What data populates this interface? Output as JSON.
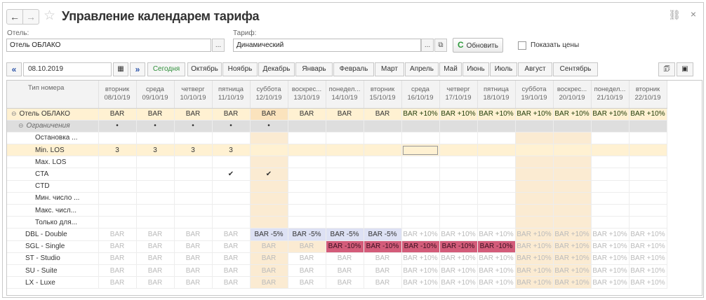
{
  "window": {
    "title": "Управление календарем тарифа"
  },
  "hotel": {
    "label": "Отель:",
    "value": "Отель ОБЛАКО",
    "select_label": "..."
  },
  "tariff": {
    "label": "Тариф:",
    "value": "Динамический",
    "select_label": "..."
  },
  "toolbar": {
    "refresh_label": "Обновить",
    "show_prices_label": "Показать цены"
  },
  "datebar": {
    "date": "08.10.2019",
    "today_label": "Сегодня",
    "months": [
      "Октябрь",
      "Ноябрь",
      "Декабрь",
      "Январь",
      "Февраль",
      "Март",
      "Апрель",
      "Май",
      "Июнь",
      "Июль",
      "Август",
      "Сентябрь"
    ]
  },
  "grid": {
    "room_header": "Тип номера",
    "columns": [
      {
        "day": "вторник",
        "date": "08/10/19"
      },
      {
        "day": "среда",
        "date": "09/10/19"
      },
      {
        "day": "четверг",
        "date": "10/10/19"
      },
      {
        "day": "пятница",
        "date": "11/10/19"
      },
      {
        "day": "суббота",
        "date": "12/10/19"
      },
      {
        "day": "воскрес...",
        "date": "13/10/19"
      },
      {
        "day": "понедел...",
        "date": "14/10/19"
      },
      {
        "day": "вторник",
        "date": "15/10/19"
      },
      {
        "day": "среда",
        "date": "16/10/19"
      },
      {
        "day": "четверг",
        "date": "17/10/19"
      },
      {
        "day": "пятница",
        "date": "18/10/19"
      },
      {
        "day": "суббота",
        "date": "19/10/19"
      },
      {
        "day": "воскрес...",
        "date": "20/10/19"
      },
      {
        "day": "понедел...",
        "date": "21/10/19"
      },
      {
        "day": "вторник",
        "date": "22/10/19"
      }
    ],
    "rows": [
      {
        "name": "Отель ОБЛАКО",
        "level": 0,
        "expand": "⊖",
        "kind": "hotel",
        "cells": [
          "BAR",
          "BAR",
          "BAR",
          "BAR",
          "BAR",
          "BAR",
          "BAR",
          "BAR",
          "BAR +10%",
          "BAR +10%",
          "BAR +10%",
          "BAR +10%",
          "BAR +10%",
          "BAR +10%",
          "BAR +10%"
        ],
        "styles": [
          "",
          "",
          "",
          "",
          "",
          "",
          "",
          "",
          "green",
          "green",
          "green",
          "green",
          "green",
          "green",
          "green"
        ]
      },
      {
        "name": "Ограничения",
        "level": 1,
        "expand": "⊖",
        "kind": "restr",
        "cells": [
          "•",
          "•",
          "•",
          "•",
          "•",
          "",
          "",
          "",
          "",
          "",
          "",
          "",
          "",
          "",
          ""
        ],
        "styles": [
          "",
          "",
          "",
          "",
          "",
          "",
          "",
          "",
          "",
          "",
          "",
          "",
          "",
          "",
          ""
        ]
      },
      {
        "name": "Остановка ...",
        "level": 2,
        "kind": "sub",
        "cells": [
          "",
          "",
          "",
          "",
          "",
          "",
          "",
          "",
          "",
          "",
          "",
          "",
          "",
          "",
          ""
        ],
        "styles": [
          "",
          "",
          "",
          "",
          "warm",
          "",
          "",
          "",
          "",
          "",
          "",
          "warm",
          "warm",
          "",
          ""
        ]
      },
      {
        "name": "Min. LOS",
        "level": 2,
        "kind": "sel",
        "cells": [
          "3",
          "3",
          "3",
          "3",
          "",
          "",
          "",
          "",
          "",
          "",
          "",
          "",
          "",
          "",
          ""
        ],
        "styles": [
          "",
          "",
          "",
          "",
          "",
          "",
          "",
          "",
          "sel-cell",
          "",
          "",
          "",
          "",
          "",
          ""
        ]
      },
      {
        "name": "Max. LOS",
        "level": 2,
        "kind": "sub",
        "cells": [
          "",
          "",
          "",
          "",
          "",
          "",
          "",
          "",
          "",
          "",
          "",
          "",
          "",
          "",
          ""
        ],
        "styles": [
          "",
          "",
          "",
          "",
          "warm",
          "",
          "",
          "",
          "",
          "",
          "",
          "warm",
          "warm",
          "",
          ""
        ]
      },
      {
        "name": "CTA",
        "level": 2,
        "kind": "sub",
        "cells": [
          "",
          "",
          "",
          "✔",
          "✔",
          "",
          "",
          "",
          "",
          "",
          "",
          "",
          "",
          "",
          ""
        ],
        "styles": [
          "",
          "",
          "",
          "",
          "warm",
          "",
          "",
          "",
          "",
          "",
          "",
          "warm",
          "warm",
          "",
          ""
        ]
      },
      {
        "name": "CTD",
        "level": 2,
        "kind": "sub",
        "cells": [
          "",
          "",
          "",
          "",
          "",
          "",
          "",
          "",
          "",
          "",
          "",
          "",
          "",
          "",
          ""
        ],
        "styles": [
          "",
          "",
          "",
          "",
          "warm",
          "",
          "",
          "",
          "",
          "",
          "",
          "warm",
          "warm",
          "",
          ""
        ]
      },
      {
        "name": "Мин. число ...",
        "level": 2,
        "kind": "sub",
        "cells": [
          "",
          "",
          "",
          "",
          "",
          "",
          "",
          "",
          "",
          "",
          "",
          "",
          "",
          "",
          ""
        ],
        "styles": [
          "",
          "",
          "",
          "",
          "warm",
          "",
          "",
          "",
          "",
          "",
          "",
          "warm",
          "warm",
          "",
          ""
        ]
      },
      {
        "name": "Макс. числ...",
        "level": 2,
        "kind": "sub",
        "cells": [
          "",
          "",
          "",
          "",
          "",
          "",
          "",
          "",
          "",
          "",
          "",
          "",
          "",
          "",
          ""
        ],
        "styles": [
          "",
          "",
          "",
          "",
          "warm",
          "",
          "",
          "",
          "",
          "",
          "",
          "warm",
          "warm",
          "",
          ""
        ]
      },
      {
        "name": "Только для...",
        "level": 2,
        "kind": "sub",
        "cells": [
          "",
          "",
          "",
          "",
          "",
          "",
          "",
          "",
          "",
          "",
          "",
          "",
          "",
          "",
          ""
        ],
        "styles": [
          "",
          "",
          "",
          "",
          "warm",
          "",
          "",
          "",
          "",
          "",
          "",
          "warm",
          "warm",
          "",
          ""
        ]
      },
      {
        "name": "DBL - Double",
        "level": 1,
        "kind": "room",
        "cells": [
          "BAR",
          "BAR",
          "BAR",
          "BAR",
          "BAR -5%",
          "BAR -5%",
          "BAR -5%",
          "BAR -5%",
          "BAR +10%",
          "BAR +10%",
          "BAR +10%",
          "BAR +10%",
          "BAR +10%",
          "BAR +10%",
          "BAR +10%"
        ],
        "styles": [
          "g",
          "g",
          "g",
          "g",
          "blue",
          "blue",
          "blue",
          "blue",
          "g",
          "g",
          "g",
          "g warm",
          "g warm",
          "g",
          "g"
        ]
      },
      {
        "name": "SGL - Single",
        "level": 1,
        "kind": "room",
        "cells": [
          "BAR",
          "BAR",
          "BAR",
          "BAR",
          "BAR",
          "BAR",
          "BAR -10%",
          "BAR -10%",
          "BAR -10%",
          "BAR -10%",
          "BAR -10%",
          "BAR +10%",
          "BAR +10%",
          "BAR +10%",
          "BAR +10%"
        ],
        "styles": [
          "g",
          "g",
          "g",
          "g",
          "g warm",
          "g warm",
          "red",
          "red",
          "red",
          "red",
          "red",
          "g warm",
          "g warm",
          "g",
          "g"
        ]
      },
      {
        "name": "ST - Studio",
        "level": 1,
        "kind": "room",
        "cells": [
          "BAR",
          "BAR",
          "BAR",
          "BAR",
          "BAR",
          "BAR",
          "BAR",
          "BAR",
          "BAR +10%",
          "BAR +10%",
          "BAR +10%",
          "BAR +10%",
          "BAR +10%",
          "BAR +10%",
          "BAR +10%"
        ],
        "styles": [
          "g",
          "g",
          "g",
          "g",
          "g warm",
          "g",
          "g",
          "g",
          "g",
          "g",
          "g",
          "g warm",
          "g warm",
          "g",
          "g"
        ]
      },
      {
        "name": "SU - Suite",
        "level": 1,
        "kind": "room",
        "cells": [
          "BAR",
          "BAR",
          "BAR",
          "BAR",
          "BAR",
          "BAR",
          "BAR",
          "BAR",
          "BAR +10%",
          "BAR +10%",
          "BAR +10%",
          "BAR +10%",
          "BAR +10%",
          "BAR +10%",
          "BAR +10%"
        ],
        "styles": [
          "g",
          "g",
          "g",
          "g",
          "g warm",
          "g",
          "g",
          "g",
          "g",
          "g",
          "g",
          "g warm",
          "g warm",
          "g",
          "g"
        ]
      },
      {
        "name": "LX - Luxe",
        "level": 1,
        "kind": "room",
        "cells": [
          "BAR",
          "BAR",
          "BAR",
          "BAR",
          "BAR",
          "BAR",
          "BAR",
          "BAR",
          "BAR +10%",
          "BAR +10%",
          "BAR +10%",
          "BAR +10%",
          "BAR +10%",
          "BAR +10%",
          "BAR +10%"
        ],
        "styles": [
          "g",
          "g",
          "g",
          "g",
          "g warm",
          "g",
          "g",
          "g",
          "g",
          "g",
          "g",
          "g warm",
          "g warm",
          "g",
          "g"
        ]
      }
    ]
  }
}
